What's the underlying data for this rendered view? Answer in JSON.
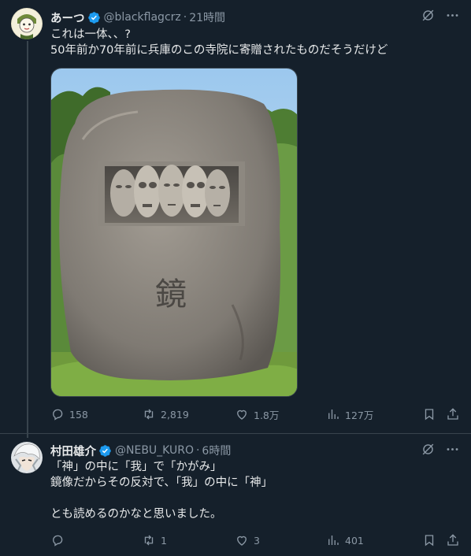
{
  "posts": [
    {
      "name": "あーつ",
      "handle": "@blackflagcrz",
      "dot": "·",
      "time": "21時間",
      "text": "これは一体、、?\n50年前か70年前に兵庫のこの寺院に寄贈されたものだそうだけど",
      "image_character": "鏡",
      "stats": {
        "replies": "158",
        "reposts": "2,819",
        "likes": "1.8万",
        "views": "127万"
      }
    },
    {
      "name": "村田雄介",
      "handle": "@NEBU_KURO",
      "dot": "·",
      "time": "6時間",
      "text": "「神」の中に「我」で「かがみ」\n鏡像だからその反対で、「我」の中に「神」\n\nとも読めるのかなと思いました。",
      "stats": {
        "replies": "",
        "reposts": "1",
        "likes": "3",
        "views": "401"
      }
    }
  ],
  "colors": {
    "background": "#15202b",
    "text": "#e7e9ea",
    "muted": "#8b98a5",
    "verified": "#1d9bf0",
    "divider": "#38444d"
  },
  "icons": [
    "verified-badge-icon",
    "grok-icon",
    "more-icon",
    "reply-icon",
    "repost-icon",
    "like-icon",
    "views-icon",
    "bookmark-icon",
    "share-icon"
  ]
}
